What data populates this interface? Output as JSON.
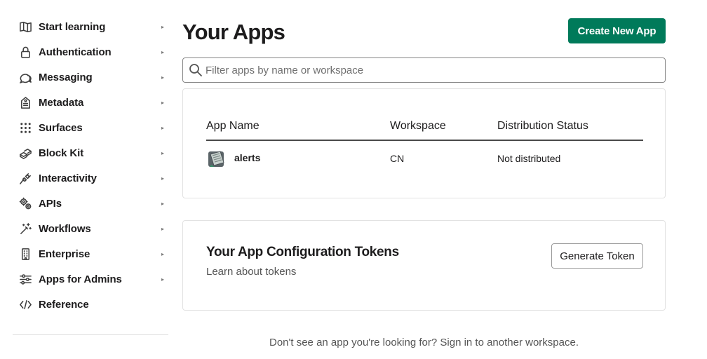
{
  "sidebar": {
    "items": [
      {
        "label": "Start learning",
        "icon": "book-icon"
      },
      {
        "label": "Authentication",
        "icon": "lock-icon"
      },
      {
        "label": "Messaging",
        "icon": "message-icon"
      },
      {
        "label": "Metadata",
        "icon": "tag-icon"
      },
      {
        "label": "Surfaces",
        "icon": "grid-icon"
      },
      {
        "label": "Block Kit",
        "icon": "blocks-icon"
      },
      {
        "label": "Interactivity",
        "icon": "plug-icon"
      },
      {
        "label": "APIs",
        "icon": "gears-icon"
      },
      {
        "label": "Workflows",
        "icon": "magic-wand-icon"
      },
      {
        "label": "Enterprise",
        "icon": "building-icon"
      },
      {
        "label": "Apps for Admins",
        "icon": "sliders-icon"
      },
      {
        "label": "Reference",
        "icon": "code-icon"
      }
    ],
    "arrow": "▸"
  },
  "header": {
    "title": "Your Apps",
    "create_label": "Create New App"
  },
  "search": {
    "placeholder": "Filter apps by name or workspace",
    "value": ""
  },
  "apps_table": {
    "columns": [
      "App Name",
      "Workspace",
      "Distribution Status"
    ],
    "rows": [
      {
        "name": "alerts",
        "workspace": "CN",
        "distribution": "Not distributed",
        "icon": "app-icon"
      }
    ]
  },
  "tokens": {
    "title": "Your App Configuration Tokens",
    "link": "Learn about tokens",
    "button_label": "Generate Token"
  },
  "footer": {
    "note": "Don't see an app you're looking for? Sign in to another workspace."
  },
  "colors": {
    "accent": "#007a5a",
    "text": "#1d1c1d",
    "muted": "#555555"
  }
}
